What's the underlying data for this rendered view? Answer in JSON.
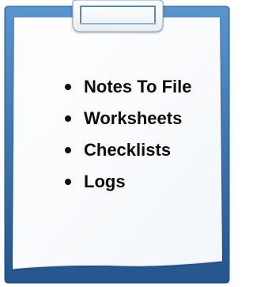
{
  "list": {
    "items": [
      {
        "label": "Notes To File"
      },
      {
        "label": "Worksheets"
      },
      {
        "label": "Checklists"
      },
      {
        "label": "Logs"
      }
    ]
  },
  "colors": {
    "board_light": "#5a95cf",
    "board_dark": "#24558d",
    "paper": "#fbfdff",
    "text": "#0b0b0b"
  },
  "icons": {
    "clip": "clipboard-clip-icon",
    "board": "clipboard-board"
  }
}
